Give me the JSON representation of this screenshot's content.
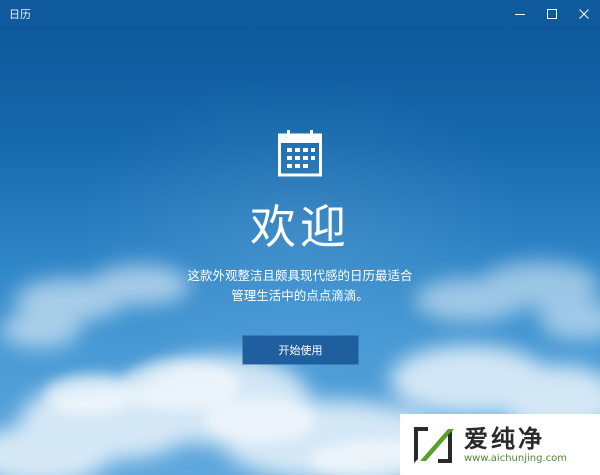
{
  "window": {
    "title": "日历"
  },
  "title_controls": {
    "minimize_icon": "minimize-icon",
    "maximize_icon": "maximize-icon",
    "close_icon": "close-icon"
  },
  "main": {
    "icon": "calendar-icon",
    "heading": "欢迎",
    "description_line1": "这款外观整洁且颇具现代感的日历最适合",
    "description_line2": "管理生活中的点点滴滴。",
    "start_button_label": "开始使用"
  },
  "watermark": {
    "brand": "爱纯净",
    "url": "www.aichunjing.com"
  },
  "colors": {
    "titlebar": "#0f5a9c",
    "button": "#1f5f9f",
    "sky_top": "#0c5596",
    "sky_bottom": "#5fa8dd"
  }
}
